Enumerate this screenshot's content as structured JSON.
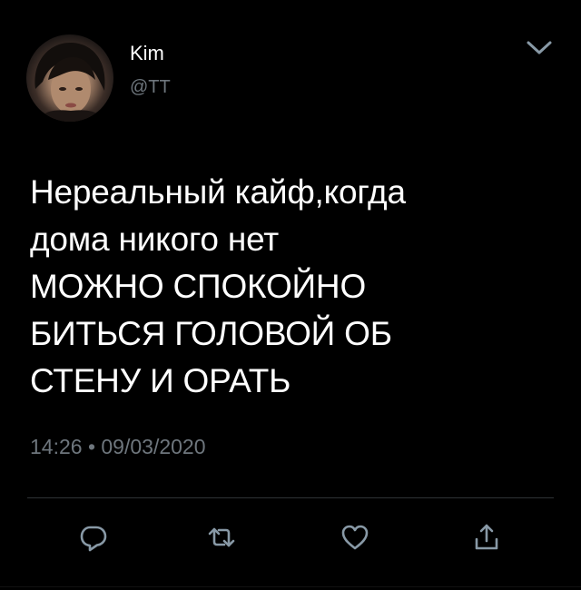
{
  "user": {
    "display_name": "Kim",
    "handle": "@TT"
  },
  "tweet": {
    "text": "Нереальный кайф,когда\nдома никого нет\nМОЖНО СПОКОЙНО\nБИТЬСЯ ГОЛОВОЙ ОБ\nСТЕНУ И ОРАТЬ",
    "timestamp": "14:26 • 09/03/2020"
  },
  "icons": {
    "more": "chevron-down-icon",
    "reply": "reply-icon",
    "retweet": "retweet-icon",
    "like": "heart-icon",
    "share": "share-icon"
  },
  "colors": {
    "background": "#000000",
    "text": "#ffffff",
    "muted": "#6e767d",
    "icon": "#8899a6",
    "divider": "#2f3336"
  }
}
